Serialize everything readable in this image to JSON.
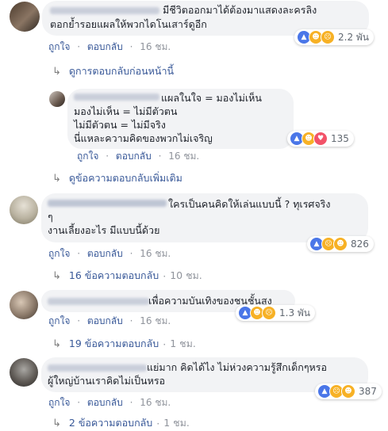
{
  "actions": {
    "like": "ถูกใจ",
    "reply": "ตอบกลับ",
    "dot": "·"
  },
  "comments": [
    {
      "lines": [
        "มีชีวิตออกมาได้ต้องมาแสดงละครลิง",
        "ตอกย้ำรอยแผลให้พวกไดโนเสาร์ดูอีก"
      ],
      "time": "16 ชม.",
      "reactions": {
        "icons": [
          "like-icon",
          "haha-icon",
          "sad-icon"
        ],
        "count": "2.2 พัน"
      }
    },
    {
      "lines": [
        "แผลในใจ = มองไม่เห็น",
        "มองไม่เห็น = ไม่มีตัวตน",
        "ไม่มีตัวตน = ไม่มีจริง",
        "นี่แหละความคิดของพวกไม่เจริญ"
      ],
      "time": "16 ชม.",
      "reactions": {
        "icons": [
          "like-icon",
          "haha-icon",
          "love-icon"
        ],
        "count": "135"
      }
    },
    {
      "lines": [
        "ใครเป็นคนคิดให้เล่นแบบนี้ ? ทุเรศจริง",
        "ๆ",
        "งานเลี้ยงอะไร มีแบบนี้ด้วย"
      ],
      "time": "16 ชม.",
      "reactions": {
        "icons": [
          "like-icon",
          "sad-icon",
          "haha-icon"
        ],
        "count": "826"
      }
    },
    {
      "lines": [
        "เพื่อความบันเทิงของชนชั้นสูง"
      ],
      "time": "16 ชม.",
      "reactions": {
        "icons": [
          "like-icon",
          "haha-icon",
          "sad-icon"
        ],
        "count": "1.3 พัน"
      }
    },
    {
      "lines": [
        "แย่มาก คิดได้ไง ไม่ห่วงความรู้สึกเด็กๆหรอ",
        "ผู้ใหญ่บ้านเราคิดไม่เป็นหรอ"
      ],
      "time": "16 ชม.",
      "reactions": {
        "icons": [
          "like-icon",
          "sad-icon",
          "haha-icon"
        ],
        "count": "387"
      }
    }
  ],
  "links": {
    "previous_replies": "ดูการตอบกลับก่อนหน้านี้",
    "more_replies": "ดูข้อความตอบกลับเพิ่มเติม",
    "replies_3": {
      "text": "16 ข้อความตอบกลับ",
      "time": "10 ชม."
    },
    "replies_4": {
      "text": "19 ข้อความตอบกลับ",
      "time": "1 ชม."
    },
    "replies_5": {
      "text": "2 ข้อความตอบกลับ",
      "time": "1 ชม."
    }
  },
  "colors": {
    "link": "#385898",
    "bubble": "#f2f3f5",
    "meta": "#90949c",
    "like": "#4a76e8",
    "haha": "#f7b125",
    "love": "#f25268"
  }
}
